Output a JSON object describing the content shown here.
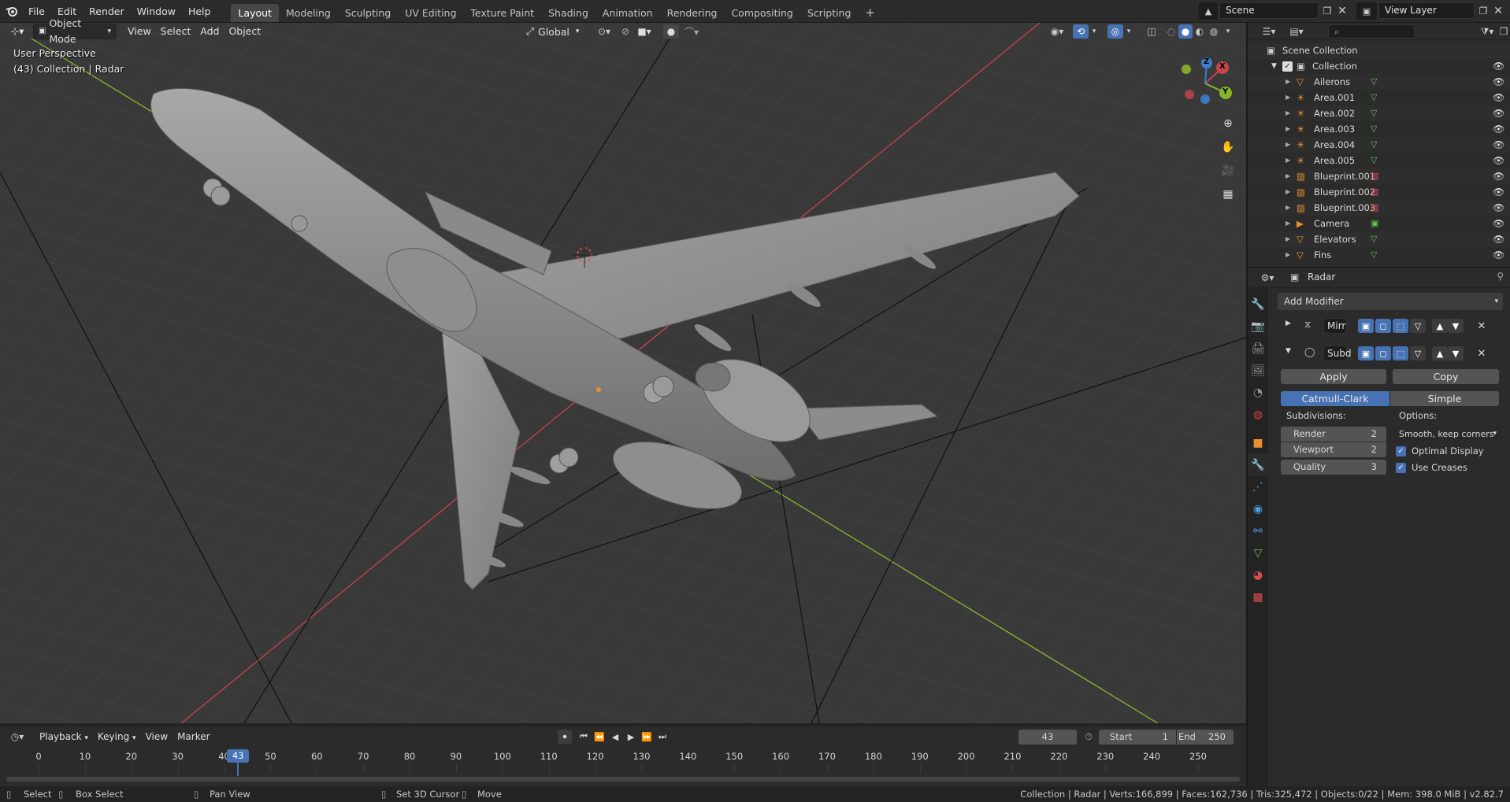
{
  "topbar": {
    "menus": [
      "File",
      "Edit",
      "Render",
      "Window",
      "Help"
    ],
    "workspaces": [
      "Layout",
      "Modeling",
      "Sculpting",
      "UV Editing",
      "Texture Paint",
      "Shading",
      "Animation",
      "Rendering",
      "Compositing",
      "Scripting"
    ],
    "active_workspace": "Layout",
    "add_tab": "+",
    "scene": "Scene",
    "view_layer": "View Layer"
  },
  "viewport_header": {
    "mode": "Object Mode",
    "menus": [
      "View",
      "Select",
      "Add",
      "Object"
    ],
    "orientation": "Global"
  },
  "viewport": {
    "perspective": "User Perspective",
    "collection_info": "(43) Collection | Radar",
    "gizmo": {
      "x": "X",
      "y": "Y",
      "z": "Z"
    }
  },
  "outliner": {
    "root": "Scene Collection",
    "collection": "Collection",
    "items": [
      {
        "name": "Ailerons",
        "icon": "mesh-icon"
      },
      {
        "name": "Area.001",
        "icon": "light-icon"
      },
      {
        "name": "Area.002",
        "icon": "light-icon"
      },
      {
        "name": "Area.003",
        "icon": "light-icon"
      },
      {
        "name": "Area.004",
        "icon": "light-icon"
      },
      {
        "name": "Area.005",
        "icon": "light-icon"
      },
      {
        "name": "Blueprint.001",
        "icon": "image-icon"
      },
      {
        "name": "Blueprint.002",
        "icon": "image-icon"
      },
      {
        "name": "Blueprint.003",
        "icon": "image-icon"
      },
      {
        "name": "Camera",
        "icon": "camera-icon"
      },
      {
        "name": "Elevators",
        "icon": "mesh-icon"
      },
      {
        "name": "Fins",
        "icon": "mesh-icon"
      }
    ]
  },
  "properties": {
    "object_name": "Radar",
    "add_modifier": "Add Modifier",
    "modifiers": [
      {
        "name": "Mirr",
        "expanded": false
      },
      {
        "name": "Subd",
        "expanded": true
      }
    ],
    "apply_label": "Apply",
    "copy_label": "Copy",
    "type_options": [
      "Catmull-Clark",
      "Simple"
    ],
    "active_type": "Catmull-Clark",
    "subdivisions_label": "Subdivisions:",
    "options_label": "Options:",
    "fields": [
      {
        "label": "Render",
        "value": "2"
      },
      {
        "label": "Viewport",
        "value": "2"
      },
      {
        "label": "Quality",
        "value": "3"
      }
    ],
    "uv_smooth": "Smooth, keep corners",
    "optimal_display": "Optimal Display",
    "use_creases": "Use Creases"
  },
  "timeline": {
    "menus": [
      "Playback",
      "Keying",
      "View",
      "Marker"
    ],
    "current_frame": "43",
    "start_label": "Start",
    "start": "1",
    "end_label": "End",
    "end": "250",
    "ticks": [
      "0",
      "10",
      "20",
      "30",
      "40",
      "50",
      "60",
      "70",
      "80",
      "90",
      "100",
      "110",
      "120",
      "130",
      "140",
      "150",
      "160",
      "170",
      "180",
      "190",
      "200",
      "210",
      "220",
      "230",
      "240",
      "250"
    ]
  },
  "statusbar": {
    "select": "Select",
    "box_select": "Box Select",
    "pan_view": "Pan View",
    "set_cursor": "Set 3D Cursor",
    "move": "Move",
    "stats": "Collection | Radar | Verts:166,899 | Faces:162,736 | Tris:325,472 | Objects:0/22 | Mem: 398.0 MiB | v2.82.7"
  },
  "colors": {
    "accent": "#4772b3",
    "x_axis": "#c8434d",
    "y_axis": "#8ab42c",
    "z_axis": "#3d7ecf",
    "playhead": "#4772b3"
  }
}
